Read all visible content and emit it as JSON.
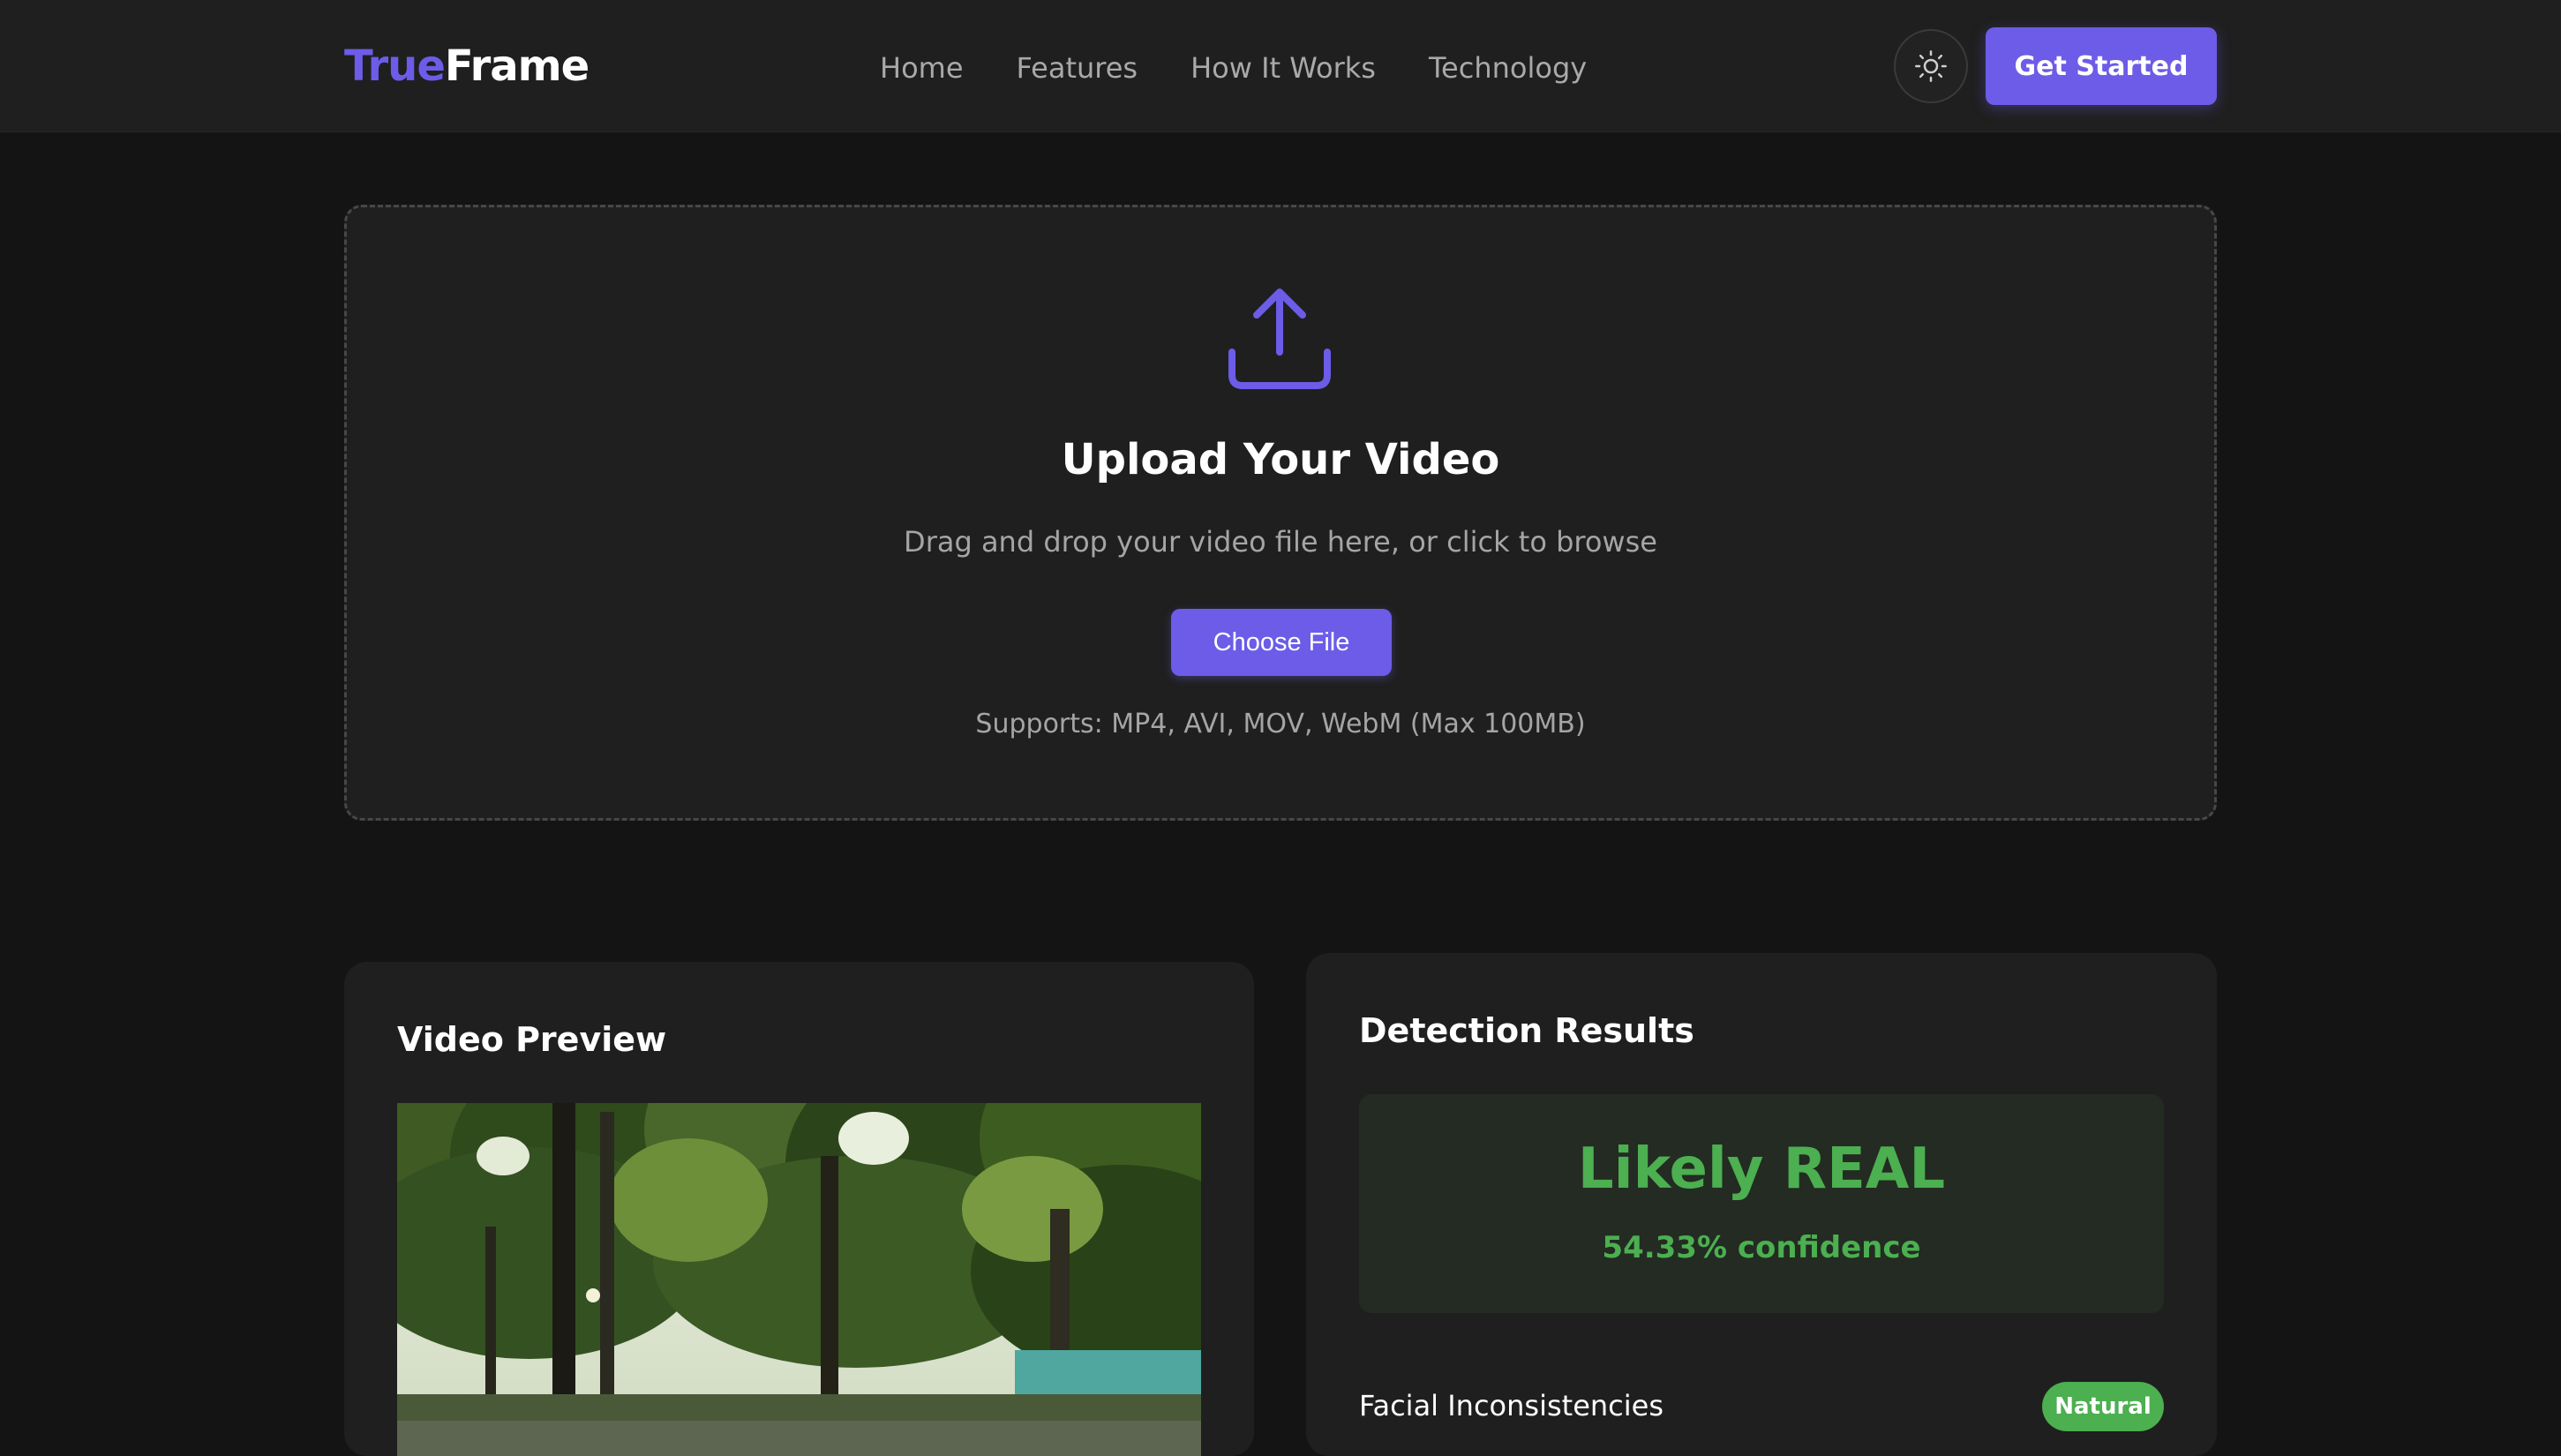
{
  "brand": {
    "accent": "True",
    "rest": "Frame",
    "accent_color": "#6c5ce7"
  },
  "nav": {
    "links": [
      {
        "label": "Home"
      },
      {
        "label": "Features"
      },
      {
        "label": "How It Works"
      },
      {
        "label": "Technology"
      }
    ],
    "theme_toggle_icon": "sun-icon",
    "cta_label": "Get Started"
  },
  "upload": {
    "icon": "upload-icon",
    "title": "Upload Your Video",
    "subtitle": "Drag and drop your video file here, or click to browse",
    "button_label": "Choose File",
    "supports": "Supports: MP4, AVI, MOV, WebM (Max 100MB)"
  },
  "preview": {
    "title": "Video Preview"
  },
  "results": {
    "title": "Detection Results",
    "verdict": "Likely REAL",
    "confidence": "54.33% confidence",
    "verdict_color": "#4caf50",
    "metrics": [
      {
        "label": "Facial Inconsistencies",
        "status": "Natural"
      }
    ]
  },
  "colors": {
    "background": "#141414",
    "surface": "#1f1f1f",
    "primary": "#6c5ce7",
    "success": "#4caf50"
  }
}
